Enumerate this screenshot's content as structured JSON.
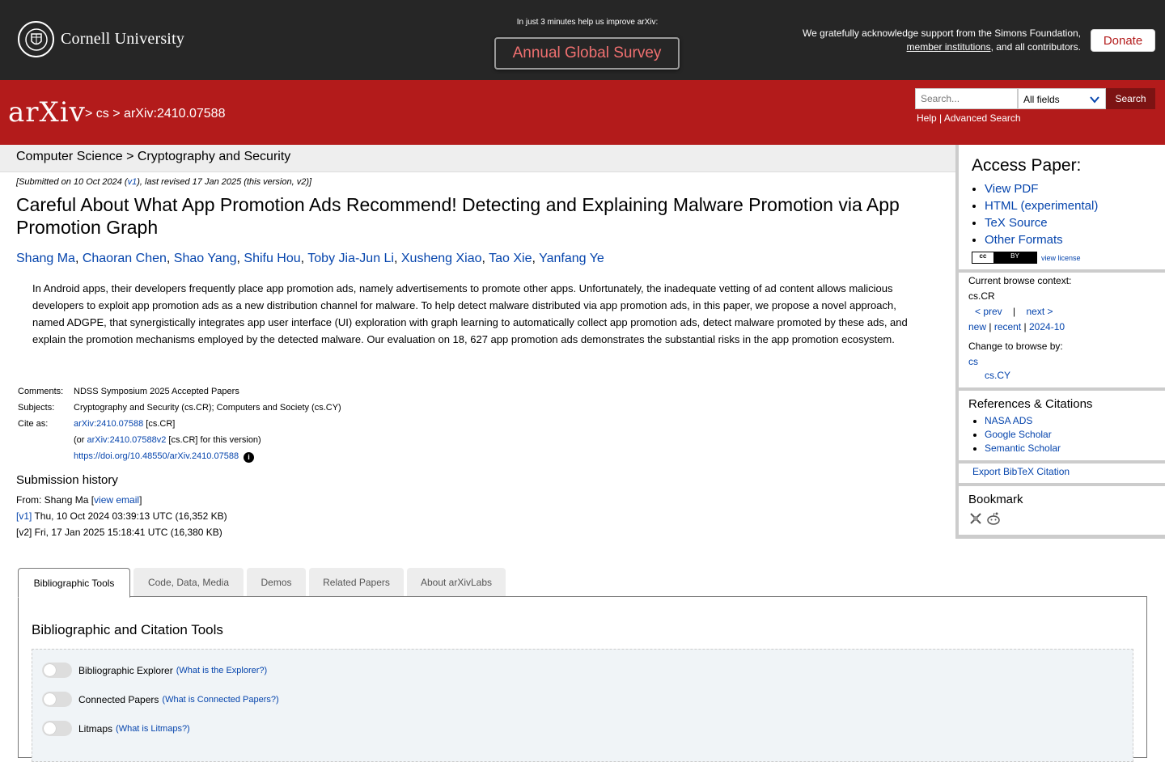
{
  "topbar": {
    "institution": "Cornell University",
    "survey_note": "In just 3 minutes help us improve arXiv:",
    "survey_button": "Annual Global Survey",
    "support_line1": "We gratefully acknowledge support from the Simons Foundation,",
    "support_link": "member institutions",
    "support_line2_tail": ", and all contributors.",
    "donate": "Donate"
  },
  "header": {
    "logo": "arXiv",
    "crumb_sep1": ">",
    "crumb_cs": "cs",
    "crumb_sep2": ">",
    "crumb_id": "arXiv:2410.07588",
    "search_placeholder": "Search...",
    "search_field": "All fields",
    "search_button": "Search",
    "help": "Help",
    "help_sep": "|",
    "advanced": "Advanced Search"
  },
  "subject_bar": "Computer Science > Cryptography and Security",
  "paper": {
    "submitted_pre": "[Submitted on 10 Oct 2024 (",
    "submitted_v1": "v1",
    "submitted_post": "), last revised 17 Jan 2025 (this version, v2)]",
    "title": "Careful About What App Promotion Ads Recommend! Detecting and Explaining Malware Promotion via App Promotion Graph",
    "authors": [
      "Shang Ma",
      "Chaoran Chen",
      "Shao Yang",
      "Shifu Hou",
      "Toby Jia-Jun Li",
      "Xusheng Xiao",
      "Tao Xie",
      "Yanfang Ye"
    ],
    "abstract": "In Android apps, their developers frequently place app promotion ads, namely advertisements to promote other apps. Unfortunately, the inadequate vetting of ad content allows malicious developers to exploit app promotion ads as a new distribution channel for malware. To help detect malware distributed via app promotion ads, in this paper, we propose a novel approach, named ADGPE, that synergistically integrates app user interface (UI) exploration with graph learning to automatically collect app promotion ads, detect malware promoted by these ads, and explain the promotion mechanisms employed by the detected malware. Our evaluation on 18, 627 app promotion ads demonstrates the substantial risks in the app promotion ecosystem.",
    "comments_label": "Comments:",
    "comments": "NDSS Symposium 2025 Accepted Papers",
    "subjects_label": "Subjects:",
    "subjects": "Cryptography and Security (cs.CR); Computers and Society (cs.CY)",
    "cite_label": "Cite as:",
    "cite_id": "arXiv:2410.07588",
    "cite_tag": " [cs.CR]",
    "cite_or_pre": "(or ",
    "cite_v2": "arXiv:2410.07588v2",
    "cite_or_post": " [cs.CR] for this version)",
    "doi": "https://doi.org/10.48550/arXiv.2410.07588",
    "doi_info": "i"
  },
  "history": {
    "title": "Submission history",
    "from_pre": "From: Shang Ma [",
    "view_email": "view email",
    "from_post": "]",
    "v1_label": "[v1]",
    "v1_text": " Thu, 10 Oct 2024 03:39:13 UTC (16,352 KB)",
    "v2_text": "[v2] Fri, 17 Jan 2025 15:18:41 UTC (16,380 KB)"
  },
  "sidebar": {
    "access_title": "Access Paper:",
    "access_links": [
      "View PDF",
      "HTML (experimental)",
      "TeX Source",
      "Other Formats"
    ],
    "cc_left": "cc",
    "cc_right": "BY",
    "view_license": "view license",
    "browse_context_label": "Current browse context:",
    "browse_context": "cs.CR",
    "prev": "< prev",
    "nav_sep": "|",
    "next": "next >",
    "new": "new",
    "recent": "recent",
    "month": "2024-10",
    "change_label": "Change to browse by:",
    "change_cs": "cs",
    "change_cscy": "cs.CY",
    "refs_title": "References & Citations",
    "refs": [
      "NASA ADS",
      "Google Scholar",
      "Semantic Scholar"
    ],
    "bibtex": "Export BibTeX Citation",
    "bookmark_title": "Bookmark"
  },
  "tabs": [
    "Bibliographic Tools",
    "Code, Data, Media",
    "Demos",
    "Related Papers",
    "About arXivLabs"
  ],
  "tools_panel": {
    "title": "Bibliographic and Citation Tools",
    "items": [
      {
        "label": "Bibliographic Explorer",
        "q": "(What is the Explorer?)"
      },
      {
        "label": "Connected Papers",
        "q": "(What is Connected Papers?)"
      },
      {
        "label": "Litmaps",
        "q": "(What is Litmaps?)"
      }
    ]
  },
  "colors": {
    "brand_red": "#b31b1b",
    "dark_bar": "#262626",
    "link": "#0645ad"
  }
}
